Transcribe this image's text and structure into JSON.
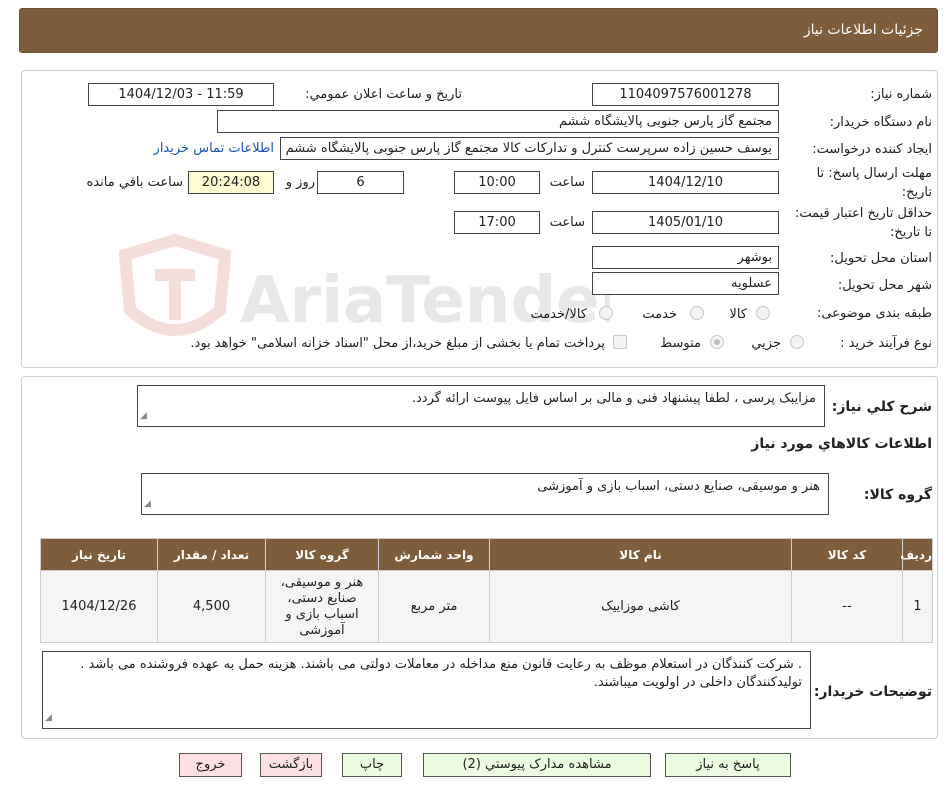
{
  "header": {
    "title": "جزئیات اطلاعات نیاز"
  },
  "form": {
    "need_number_label": "شماره نیاز:",
    "need_number": "1104097576001278",
    "announce_label": "تاریخ و ساعت اعلان عمومي:",
    "announce_value": "1404/12/03 - 11:59",
    "buyer_org_label": "نام دستگاه خریدار:",
    "buyer_org": "مجتمع گاز پارس جنوبی  پالایشگاه ششم",
    "requester_label": "ایجاد کننده درخواست:",
    "requester": "یوسف حسین زاده سرپرست کنترل و تدارکات کالا مجتمع گاز پارس جنوبی  پالایشگاه ششم",
    "contact_link": "اطلاعات تماس خریدار",
    "deadline_label": "مهلت ارسال پاسخ: تا تاریخ:",
    "deadline_date": "1404/12/10",
    "time_label": "ساعت",
    "deadline_time": "10:00",
    "days_value": "6",
    "days_label": "روز و",
    "remaining_time": "20:24:08",
    "remaining_label": "ساعت باقي مانده",
    "validity_label": "حداقل تاریخ اعتبار قیمت: تا تاریخ:",
    "validity_date": "1405/01/10",
    "validity_time": "17:00",
    "province_label": "استان محل تحویل:",
    "province": "بوشهر",
    "city_label": "شهر محل تحویل:",
    "city": "عسلویه",
    "category_label": "طبقه بندی موضوعی:",
    "category_options": [
      "کالا",
      "خدمت",
      "کالا/خدمت"
    ],
    "category_selected": "کالا",
    "process_label": "نوع فرآیند خرید :",
    "process_options": [
      "جزیي",
      "متوسط"
    ],
    "process_selected": "متوسط",
    "treasury_note": "پرداخت تمام یا بخشی از مبلغ خرید،از محل \"اسناد خزانه اسلامی\" خواهد بود."
  },
  "description": {
    "summary_label": "شرح کلي نیاز:",
    "summary": "مزایبک پرسی ، لطفا پیشنهاد فنی و مالی بر اساس فایل پیوست ارائه گردد.",
    "goods_info_title": "اطلاعات کالاهاي مورد نیاز",
    "group_label": "گروه کالا:",
    "group_value": "هنر و موسیقی، صنایع دستی، اسباب بازی و آموزشی"
  },
  "table": {
    "headers": [
      "ردیف",
      "کد کالا",
      "نام کالا",
      "واحد شمارش",
      "گروه کالا",
      "تعداد / مقدار",
      "تاریخ نیاز"
    ],
    "rows": [
      [
        "1",
        "--",
        "کاشی موزاییک",
        "متر مربع",
        "هنر و موسیقی، صنایع دستی، اسباب بازی و آموزشی",
        "4,500",
        "1404/12/26"
      ]
    ]
  },
  "buyer_notes": {
    "label": "توضیحات خریدار:",
    "text": ". شرکت کنندگان در استعلام موظف به رعایت قانون منع مداخله در معاملات دولتی می باشند. هزینه حمل به عهده فروشنده می باشد . تولیدکنندگان داخلی در اولویت میباشند."
  },
  "buttons": {
    "reply": "پاسخ به نیاز",
    "attachments": "مشاهده مدارک پیوستي (2)",
    "print": "چاپ",
    "back": "بازگشت",
    "exit": "خروج"
  },
  "watermark": {
    "text": "AriaTender.neT"
  },
  "colors": {
    "header_bg": "#7d5d3b",
    "link": "#1a55b8",
    "button_green": "#ecfce0",
    "button_red": "#fce0e4",
    "highlight": "#fefbd2"
  }
}
